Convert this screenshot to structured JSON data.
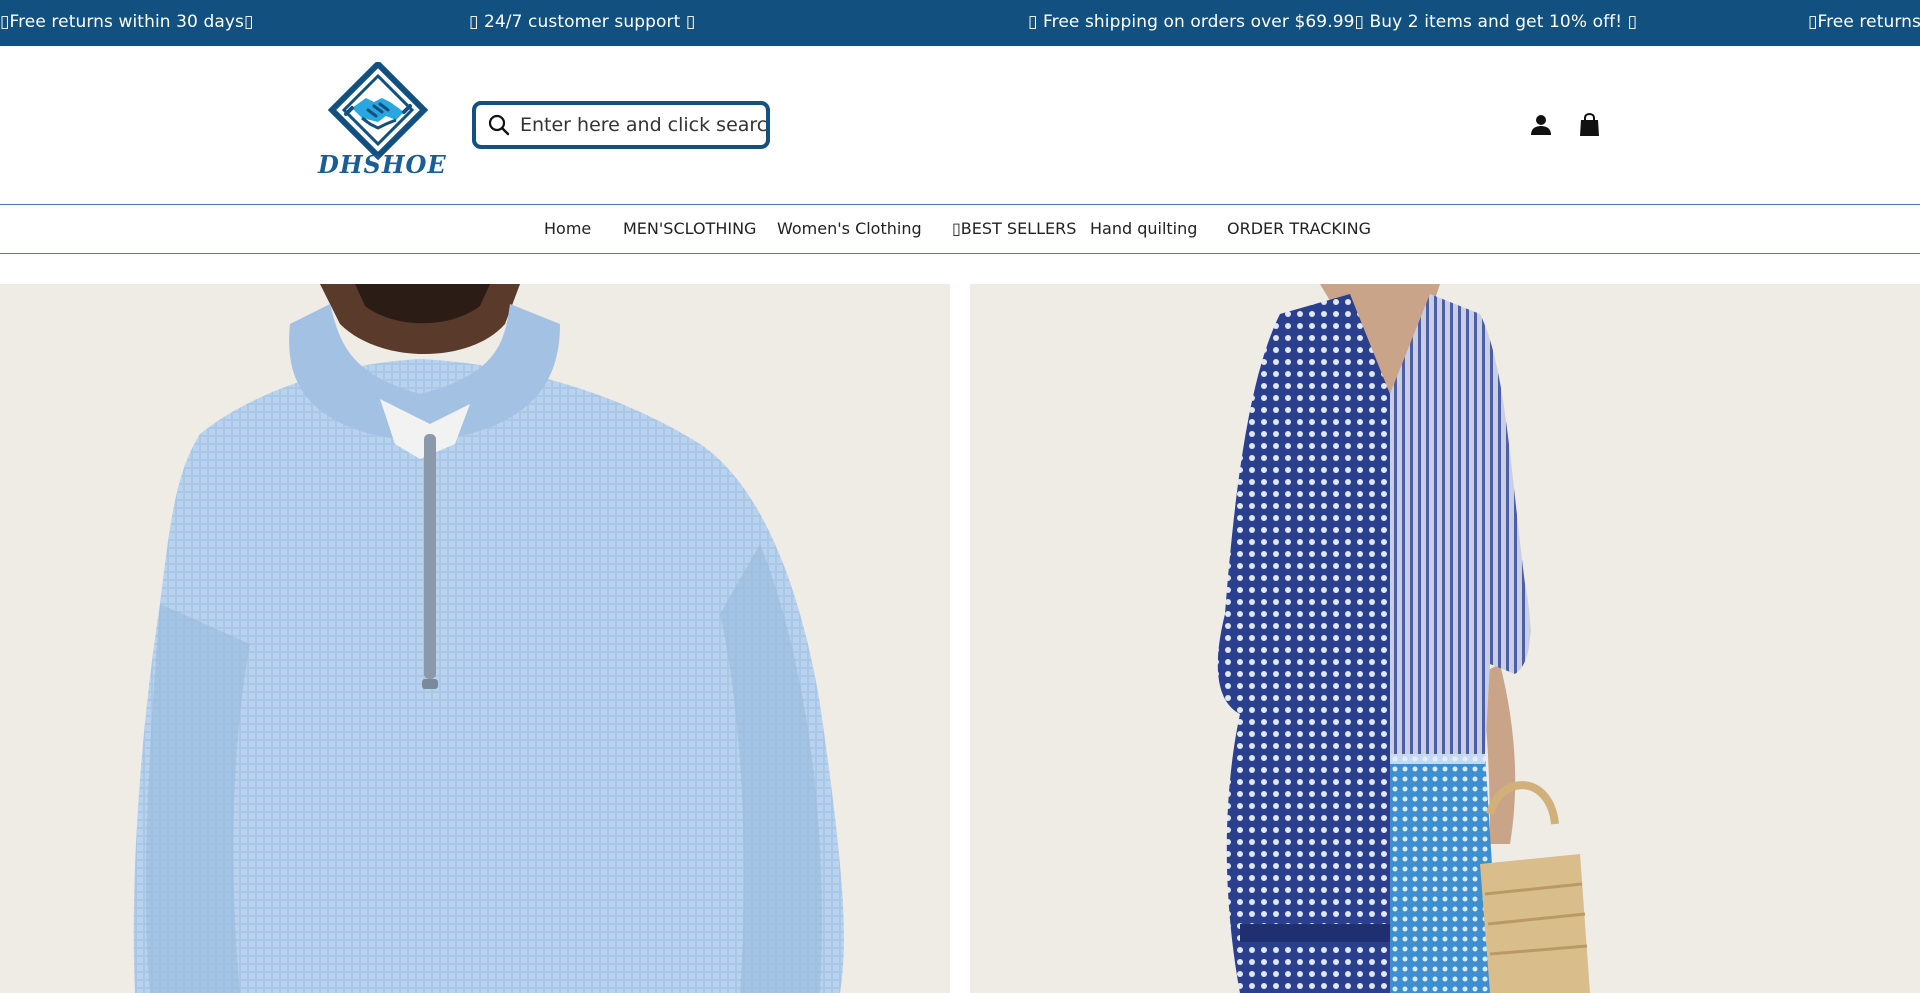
{
  "announcement": {
    "messages": [
      "▯Free returns within 30 days▯",
      "▯ 24/7 customer support ▯",
      "▯ Free shipping on orders over $69.99▯ Buy 2 items and get 10% off! ▯",
      "▯Free returns w"
    ]
  },
  "brand": {
    "name": "DHSHOE",
    "color": "#12507f"
  },
  "search": {
    "placeholder": "Enter here and click search",
    "value": ""
  },
  "header_icons": {
    "account": "person-icon",
    "cart": "shopping-bag-icon"
  },
  "nav": {
    "items": [
      "Home",
      "MEN'SCLOTHING",
      "Women's Clothing",
      "▯BEST SELLERS",
      "Hand quilting",
      "ORDER TRACKING"
    ]
  },
  "hero": {
    "tiles": [
      {
        "image": "mens-quarter-zip-waffle-sweater-image"
      },
      {
        "image": "womens-patchwork-print-maxi-dress-image"
      }
    ]
  },
  "colors": {
    "announcement_bg": "#12507f",
    "tile_bg": "#efebe5",
    "sweater": "#a9c7e6",
    "dress_navy": "#2b3f8f"
  }
}
